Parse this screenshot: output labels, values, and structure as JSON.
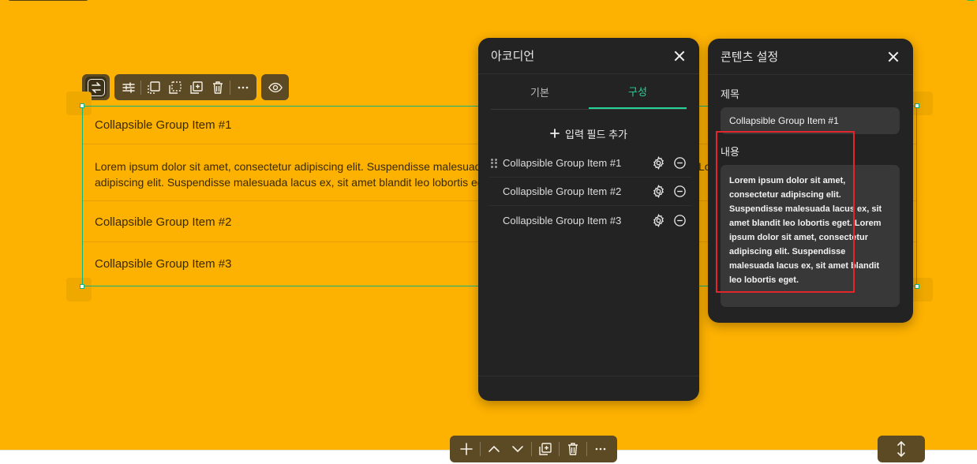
{
  "accordion": {
    "items": [
      {
        "title": "Collapsible Group Item #1"
      },
      {
        "title": "Collapsible Group Item #2"
      },
      {
        "title": "Collapsible Group Item #3"
      }
    ],
    "body": "Lorem ipsum dolor sit amet, consectetur adipiscing elit. Suspendisse malesuada lacus ex, sit amet blandit leo lobortis eget. Lorem ipsum dolor sit amet, consectetur adipiscing elit. Suspendisse malesuada lacus ex, sit amet blandit leo lobortis eget."
  },
  "accordion_panel": {
    "title": "아코디언",
    "tabs": [
      {
        "label": "기본"
      },
      {
        "label": "구성"
      }
    ],
    "active_tab": "구성",
    "add_field_label": "입력 필드 추가",
    "fields": [
      {
        "label": "Collapsible Group Item #1"
      },
      {
        "label": "Collapsible Group Item #2"
      },
      {
        "label": "Collapsible Group Item #3"
      }
    ]
  },
  "content_panel": {
    "title": "콘텐츠 설정",
    "title_label": "제목",
    "title_value": "Collapsible Group Item #1",
    "content_label": "내용",
    "content_value": "Lorem ipsum dolor sit amet, consectetur adipiscing elit. Suspendisse malesuada lacus ex, sit amet blandit leo lobortis eget. Lorem ipsum dolor sit amet, consectetur adipiscing elit. Suspendisse malesuada lacus ex, sit amet blandit leo lobortis eget."
  },
  "colors": {
    "canvas": "#fdb100",
    "panel_bg": "#232323",
    "accent": "#23d39a",
    "toolbar": "#5c4a24",
    "highlight": "#e1262c"
  }
}
